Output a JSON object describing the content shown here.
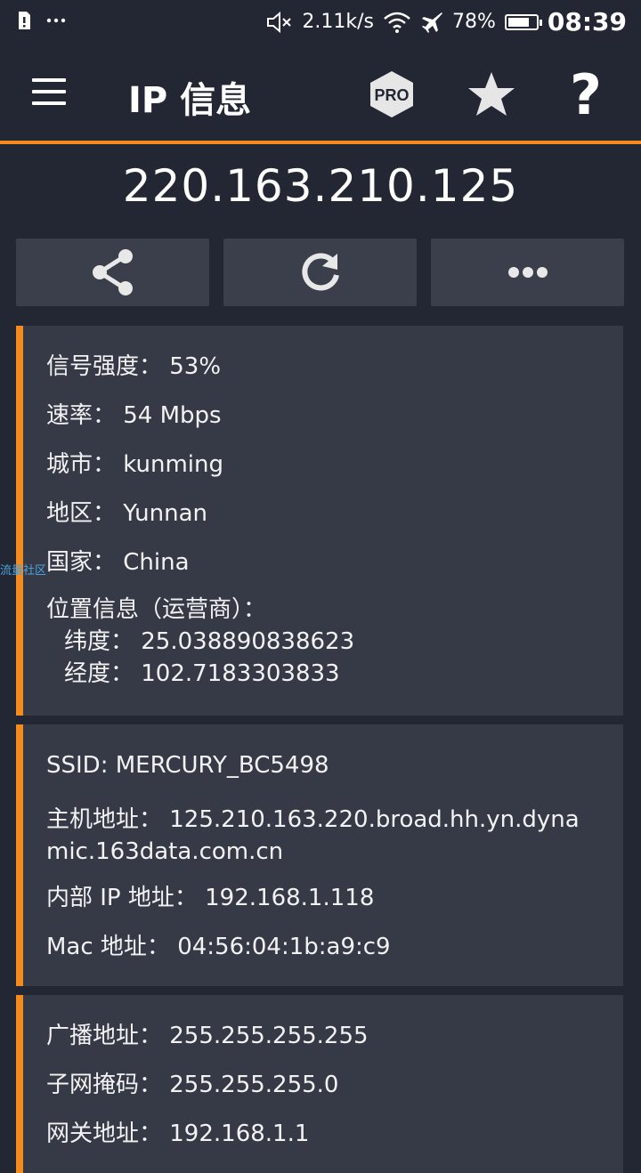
{
  "status_bar": {
    "notification_icons": [
      "sim-alert-icon",
      "more-dots-icon"
    ],
    "network_speed": "2.11k/s",
    "battery_percent": "78%",
    "battery_level": 0.78,
    "time": "08:39",
    "icons": [
      "mute-icon",
      "wifi-icon",
      "airplane-icon",
      "battery-icon"
    ]
  },
  "appbar": {
    "title": "IP 信息",
    "pro_label": "PRO",
    "help_label": "?"
  },
  "ip_address": "220.163.210.125",
  "actions": [
    "share-icon",
    "refresh-icon",
    "more-icon"
  ],
  "card1": {
    "signal": "信号强度： 53%",
    "speed": "速率： 54 Mbps",
    "city": "城市： kunming",
    "region": "地区： Yunnan",
    "country": "国家： China",
    "location_title": "位置信息（运营商）：",
    "latitude": "纬度： 25.038890838623",
    "longitude": "经度： 102.7183303833"
  },
  "card2": {
    "ssid": "SSID: MERCURY_BC5498",
    "host": "主机地址： 125.210.163.220.broad.hh.yn.dynamic.163data.com.cn",
    "internal_ip": "内部 IP 地址： 192.168.1.118",
    "mac": "Mac 地址： 04:56:04:1b:a9:c9"
  },
  "card3": {
    "broadcast": "广播地址： 255.255.255.255",
    "subnet": "子网掩码： 255.255.255.0",
    "gateway": "网关地址： 192.168.1.1"
  },
  "watermark": "流量社区",
  "colors": {
    "accent": "#f58a1f",
    "background": "#232733",
    "card": "#363a47",
    "button": "#3b3f4c"
  }
}
